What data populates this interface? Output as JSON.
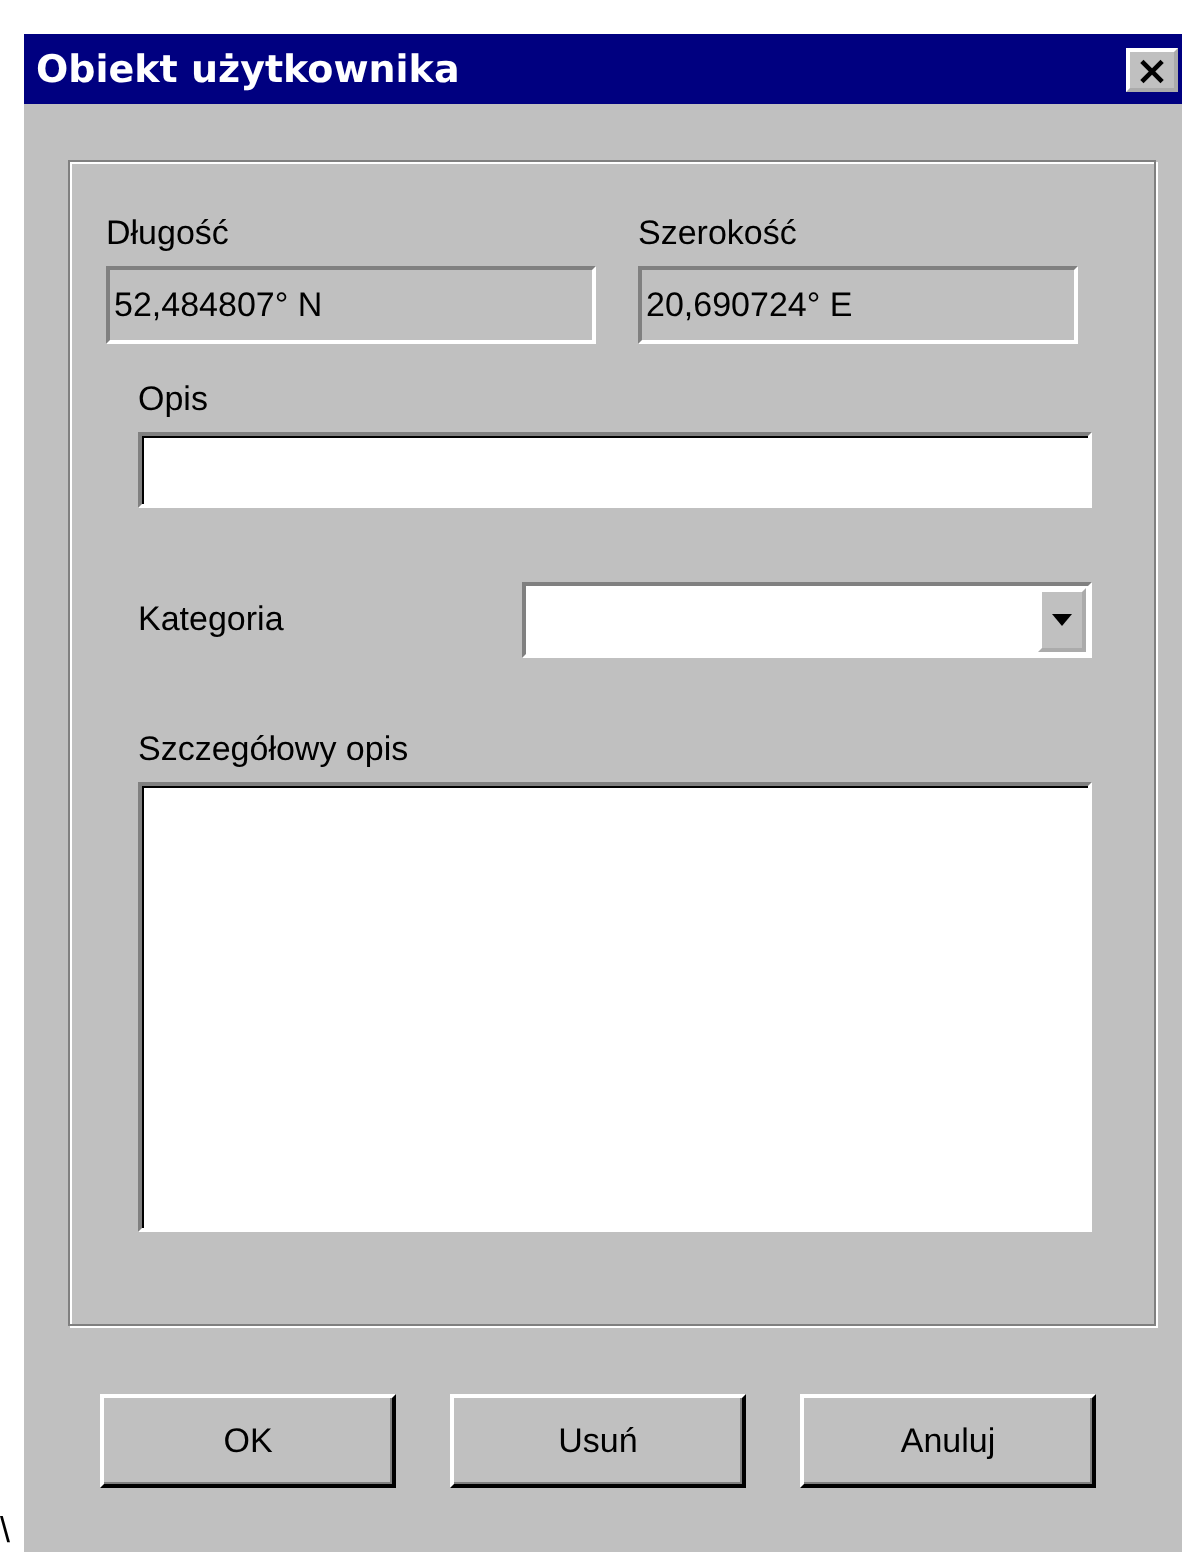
{
  "window": {
    "title": "Obiekt użytkownika",
    "close_glyph": "×"
  },
  "fields": {
    "longitude": {
      "label": "Długość",
      "value": "52,484807° N"
    },
    "latitude": {
      "label": "Szerokość",
      "value": "20,690724° E"
    },
    "description": {
      "label": "Opis"
    },
    "category": {
      "label": "Kategoria"
    },
    "details": {
      "label": "Szczegółowy opis"
    }
  },
  "buttons": [
    "OK",
    "Usuń",
    "Anuluj"
  ],
  "stray_mark": "\\"
}
